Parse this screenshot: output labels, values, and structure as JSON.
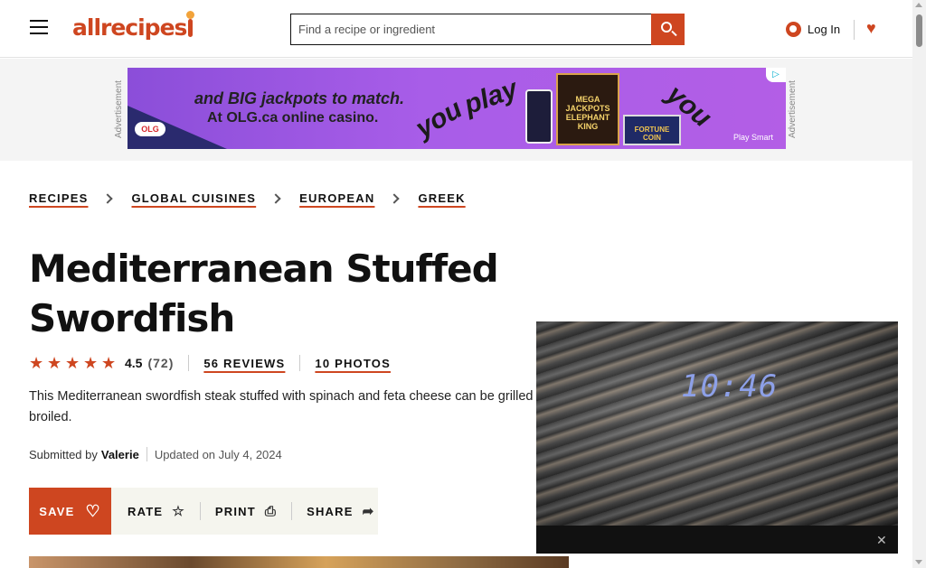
{
  "header": {
    "logo_text": "allrecipes",
    "search_placeholder": "Find a recipe or ingredient",
    "login_label": "Log In"
  },
  "ad": {
    "label": "Advertisement",
    "line1": "and BIG jackpots to match.",
    "line2": "At OLG.ca online casino.",
    "word_you": "you",
    "word_play": "play",
    "brand": "OLG",
    "game1": "MEGA JACKPOTS ELEPHANT KING",
    "game2": "FORTUNE COIN",
    "footer": "Play Smart"
  },
  "breadcrumb": [
    "RECIPES",
    "GLOBAL CUISINES",
    "EUROPEAN",
    "GREEK"
  ],
  "recipe": {
    "title": "Mediterranean Stuffed Swordfish",
    "rating": "4.5",
    "rating_count": "(72)",
    "reviews_link": "56 REVIEWS",
    "photos_link": "10 PHOTOS",
    "description": "This Mediterranean swordfish steak stuffed with spinach and feta cheese can be grilled or broiled.",
    "submitted_prefix": "Submitted by",
    "author": "Valerie",
    "updated": "Updated on July 4, 2024"
  },
  "actions": {
    "save": "SAVE",
    "rate": "RATE",
    "print": "PRINT",
    "share": "SHARE"
  },
  "video": {
    "timestamp": "10:46"
  },
  "colors": {
    "brand": "#ce4620",
    "ad_purple": "#a85de8"
  }
}
